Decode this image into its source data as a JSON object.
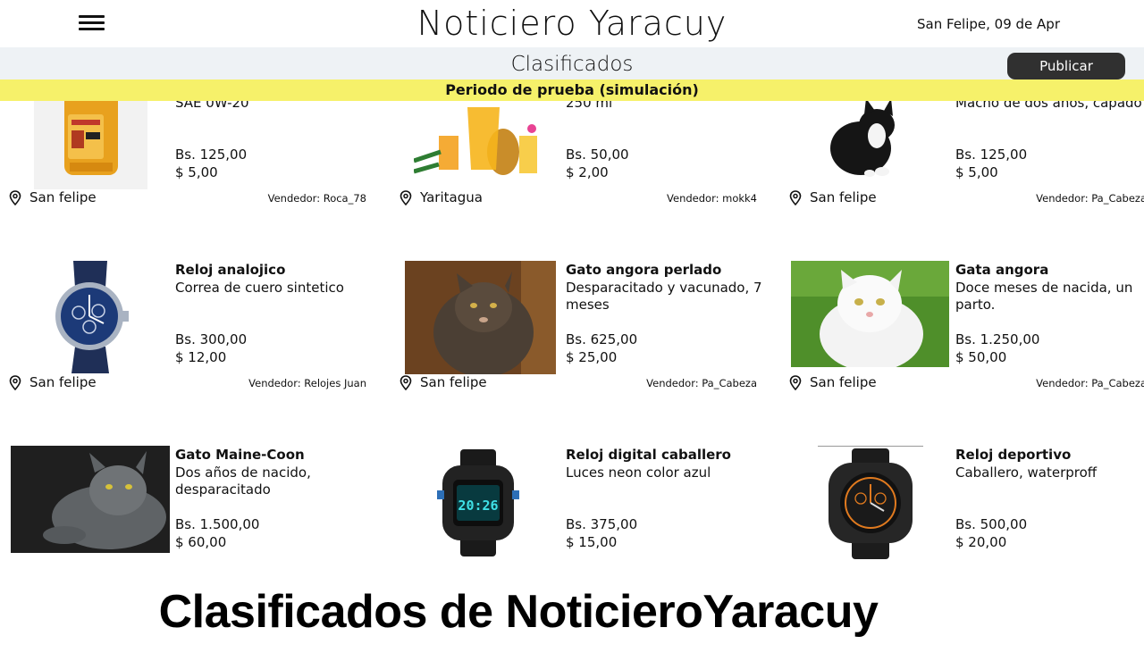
{
  "header": {
    "site_title": "Noticiero Yaracuy",
    "date": "San Felipe, 09 de Apr",
    "section_title": "Clasificados",
    "publish_label": "Publicar",
    "trial_notice": "Periodo de prueba (simulación)"
  },
  "listings": [
    {
      "title": "",
      "desc": "SAE 0W-20",
      "price_bs": "Bs. 125,00",
      "price_usd": "$ 5,00",
      "location": "San felipe",
      "seller": "Vendedor: Roca_78"
    },
    {
      "title": "",
      "desc": "250 ml",
      "price_bs": "Bs. 50,00",
      "price_usd": "$ 2,00",
      "location": "Yaritagua",
      "seller": "Vendedor: mokk4"
    },
    {
      "title": "",
      "desc": "Macho de dos años, capado",
      "price_bs": "Bs. 125,00",
      "price_usd": "$ 5,00",
      "location": "San felipe",
      "seller": "Vendedor: Pa_Cabeza"
    },
    {
      "title": "Reloj analojico",
      "desc": "Correa de cuero sintetico",
      "price_bs": "Bs. 300,00",
      "price_usd": "$ 12,00",
      "location": "San felipe",
      "seller": "Vendedor: Relojes Juan"
    },
    {
      "title": "Gato angora perlado",
      "desc": "Desparacitado y vacunado, 7 meses",
      "price_bs": "Bs. 625,00",
      "price_usd": "$ 25,00",
      "location": "San felipe",
      "seller": "Vendedor: Pa_Cabeza"
    },
    {
      "title": "Gata angora",
      "desc": "Doce meses de nacida, un parto.",
      "price_bs": "Bs. 1.250,00",
      "price_usd": "$ 50,00",
      "location": "San felipe",
      "seller": "Vendedor: Pa_Cabeza"
    },
    {
      "title": "Gato Maine-Coon",
      "desc": "Dos años de nacido, desparacitado",
      "price_bs": "Bs. 1.500,00",
      "price_usd": "$ 60,00"
    },
    {
      "title": "Reloj digital caballero",
      "desc": "Luces neon color azul",
      "price_bs": "Bs. 375,00",
      "price_usd": "$ 15,00",
      "watch_display": "20:26"
    },
    {
      "title": "Reloj deportivo",
      "desc": "Caballero, waterproff",
      "price_bs": "Bs. 500,00",
      "price_usd": "$ 20,00"
    }
  ],
  "banner": "Clasificados de NoticieroYaracuy",
  "icons": {
    "menu": "hamburger-icon",
    "location": "map-pin-icon"
  },
  "colors": {
    "trial_bar": "#f6f16a",
    "subbar": "#eef2f5",
    "publish_button": "#303030"
  }
}
